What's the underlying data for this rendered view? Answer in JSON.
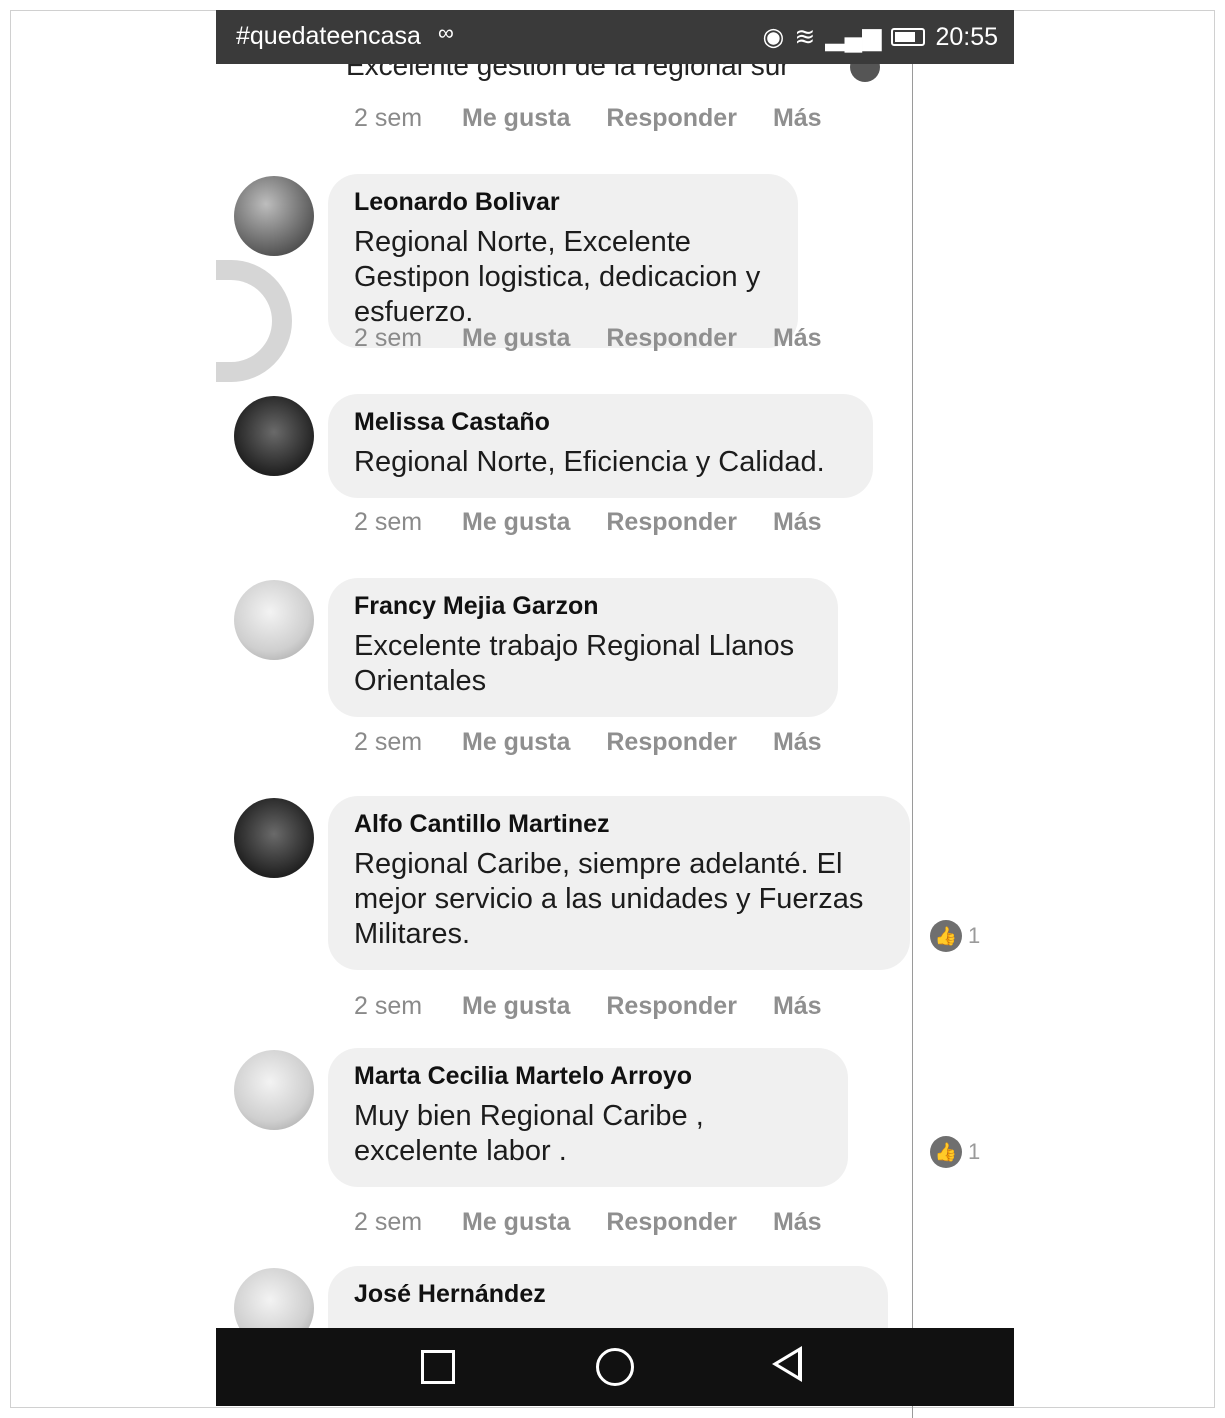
{
  "status_bar": {
    "hashtag": "#quedateencasa",
    "hashtag_icon": "infinity-icon",
    "time": "20:55"
  },
  "clipped_top": {
    "text": "Excelente gestion de la regional sur"
  },
  "actions": {
    "time": "2 sem",
    "like": "Me gusta",
    "reply": "Responder",
    "more": "Más"
  },
  "comments": [
    {
      "author": "Leonardo Bolivar",
      "text": "Regional Norte, Excelente Gestipon logistica, dedicacion y esfuerzo.",
      "time": "2 sem",
      "reactions": ""
    },
    {
      "author": "Melissa Castaño",
      "text": "Regional Norte, Eficiencia y Calidad.",
      "time": "2 sem",
      "reactions": ""
    },
    {
      "author": "Francy Mejia Garzon",
      "text": "Excelente trabajo Regional Llanos Orientales",
      "time": "2 sem",
      "reactions": ""
    },
    {
      "author": "Alfo Cantillo Martinez",
      "text": "Regional Caribe, siempre adelanté. El mejor servicio a las unidades y Fuerzas Militares.",
      "time": "2 sem",
      "reactions": "1"
    },
    {
      "author": "Marta Cecilia Martelo Arroyo",
      "text": "Muy bien Regional Caribe , excelente labor .",
      "time": "2 sem",
      "reactions": "1"
    },
    {
      "author": "José Hernández",
      "text": "",
      "time": "",
      "reactions": ""
    }
  ],
  "nav_bar": {
    "recent": "square-icon",
    "home": "circle-icon",
    "back": "triangle-back-icon"
  }
}
